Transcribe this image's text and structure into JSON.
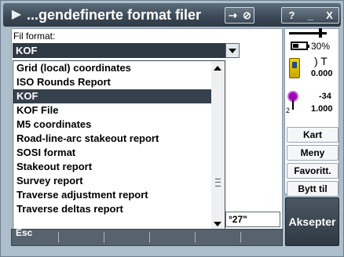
{
  "window": {
    "title": "...gendefinerte format filer",
    "title_icon": "app-icon",
    "controls": {
      "nav_icons": [
        "arrow-in-icon",
        "no-entry-icon"
      ],
      "help": "?",
      "minimize": "_",
      "close": "X"
    }
  },
  "form": {
    "file_format_label": "Fil format:",
    "file_format_value": "KOF",
    "options": [
      {
        "label": "Grid (local) coordinates",
        "selected": false
      },
      {
        "label": "ISO Rounds Report",
        "selected": false
      },
      {
        "label": "KOF",
        "selected": true
      },
      {
        "label": "KOF File",
        "selected": false
      },
      {
        "label": "M5 coordinates",
        "selected": false
      },
      {
        "label": "Road-line-arc stakeout report",
        "selected": false
      },
      {
        "label": "SOSI format",
        "selected": false
      },
      {
        "label": "Stakeout report",
        "selected": false
      },
      {
        "label": "Survey report",
        "selected": false
      },
      {
        "label": "Traverse adjustment report",
        "selected": false
      },
      {
        "label": "Traverse deltas report",
        "selected": false
      }
    ],
    "behind_field_fragment": "°27\"",
    "esc_label": "Esc"
  },
  "status": {
    "battery_percent": "30%",
    "instrument_label": ") T",
    "instrument_value": "0.000",
    "target_top": "-34",
    "target_small": "2",
    "target_value": "1.000"
  },
  "sidebar": {
    "buttons": [
      {
        "label": "Kart",
        "name": "map-button"
      },
      {
        "label": "Meny",
        "name": "menu-button"
      },
      {
        "label": "Favoritt.",
        "name": "favorites-button"
      },
      {
        "label": "Bytt til",
        "name": "switch-to-button"
      }
    ],
    "accept_label": "Aksepter"
  },
  "colors": {
    "titlebar": "#3a4754",
    "selection": "#35414c",
    "accent_target": "#9b00b3",
    "instrument": "#f3d300"
  }
}
